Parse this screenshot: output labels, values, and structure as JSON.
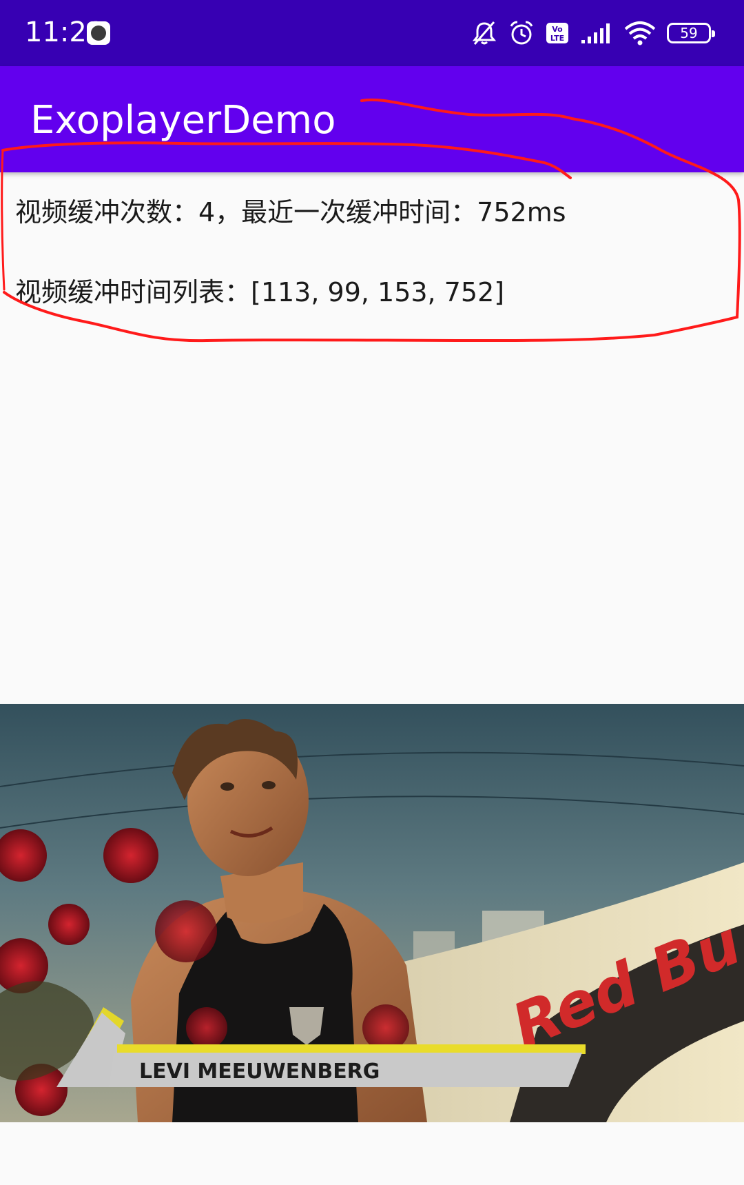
{
  "status_bar": {
    "time": "11:21",
    "battery": "59",
    "icons": [
      "clock-app-icon",
      "mute-bell-icon",
      "alarm-icon",
      "volte-icon",
      "signal-icon",
      "wifi-icon",
      "battery-icon"
    ],
    "volte_label": "Vo\nLTE"
  },
  "app_bar": {
    "title": "ExoplayerDemo",
    "color": "#6200ee"
  },
  "content": {
    "buffer_summary": "视频缓冲次数：4，最近一次缓冲时间：752ms",
    "buffer_list": "视频缓冲时间列表：[113, 99, 153, 752]"
  },
  "video": {
    "lower_third_name": "LEVI MEEUWENBERG",
    "banner_text": "Red Bu"
  },
  "colors": {
    "status_bar": "#3700b3",
    "annotation": "#ff1a1a",
    "background": "#fafafa"
  }
}
